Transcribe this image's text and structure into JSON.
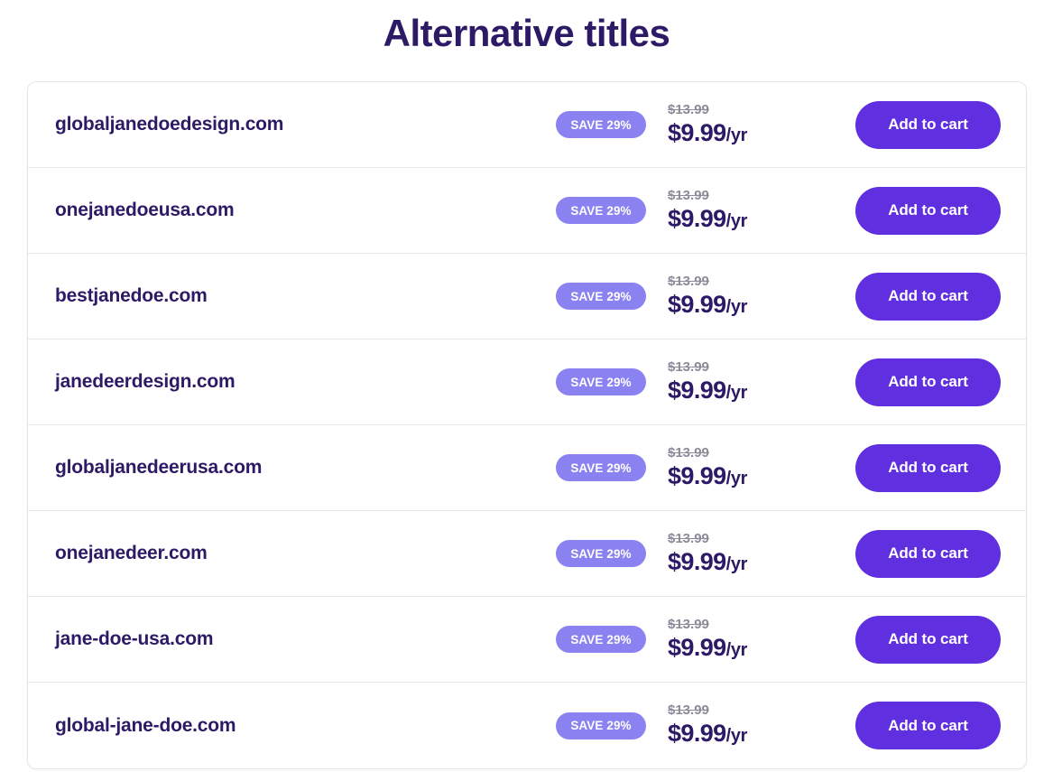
{
  "page": {
    "title": "Alternative titles"
  },
  "results": {
    "save_badge_label": "SAVE 29%",
    "old_price": "$13.99",
    "price_amount": "$9.99",
    "price_period": "/yr",
    "add_to_cart_label": "Add to cart",
    "colors": {
      "title": "#2d1a66",
      "domain_text": "#2d1a66",
      "badge_background": "#8b82f2",
      "badge_text": "#ffffff",
      "old_price_text": "#8b8b99",
      "price_text": "#2d1a66",
      "button_background": "#5f2fe0",
      "button_text": "#ffffff",
      "card_border": "#e4e4e8",
      "row_divider": "#e8e8ec",
      "page_background": "#ffffff"
    },
    "rows": [
      {
        "domain": "globaljanedoedesign.com",
        "badge": "SAVE 29%",
        "old_price": "$13.99",
        "price_amount": "$9.99",
        "price_period": "/yr",
        "button": "Add to cart"
      },
      {
        "domain": "onejanedoeusa.com",
        "badge": "SAVE 29%",
        "old_price": "$13.99",
        "price_amount": "$9.99",
        "price_period": "/yr",
        "button": "Add to cart"
      },
      {
        "domain": "bestjanedoe.com",
        "badge": "SAVE 29%",
        "old_price": "$13.99",
        "price_amount": "$9.99",
        "price_period": "/yr",
        "button": "Add to cart"
      },
      {
        "domain": "janedeerdesign.com",
        "badge": "SAVE 29%",
        "old_price": "$13.99",
        "price_amount": "$9.99",
        "price_period": "/yr",
        "button": "Add to cart"
      },
      {
        "domain": "globaljanedeerusa.com",
        "badge": "SAVE 29%",
        "old_price": "$13.99",
        "price_amount": "$9.99",
        "price_period": "/yr",
        "button": "Add to cart"
      },
      {
        "domain": "onejanedeer.com",
        "badge": "SAVE 29%",
        "old_price": "$13.99",
        "price_amount": "$9.99",
        "price_period": "/yr",
        "button": "Add to cart"
      },
      {
        "domain": "jane-doe-usa.com",
        "badge": "SAVE 29%",
        "old_price": "$13.99",
        "price_amount": "$9.99",
        "price_period": "/yr",
        "button": "Add to cart"
      },
      {
        "domain": "global-jane-doe.com",
        "badge": "SAVE 29%",
        "old_price": "$13.99",
        "price_amount": "$9.99",
        "price_period": "/yr",
        "button": "Add to cart"
      }
    ]
  }
}
